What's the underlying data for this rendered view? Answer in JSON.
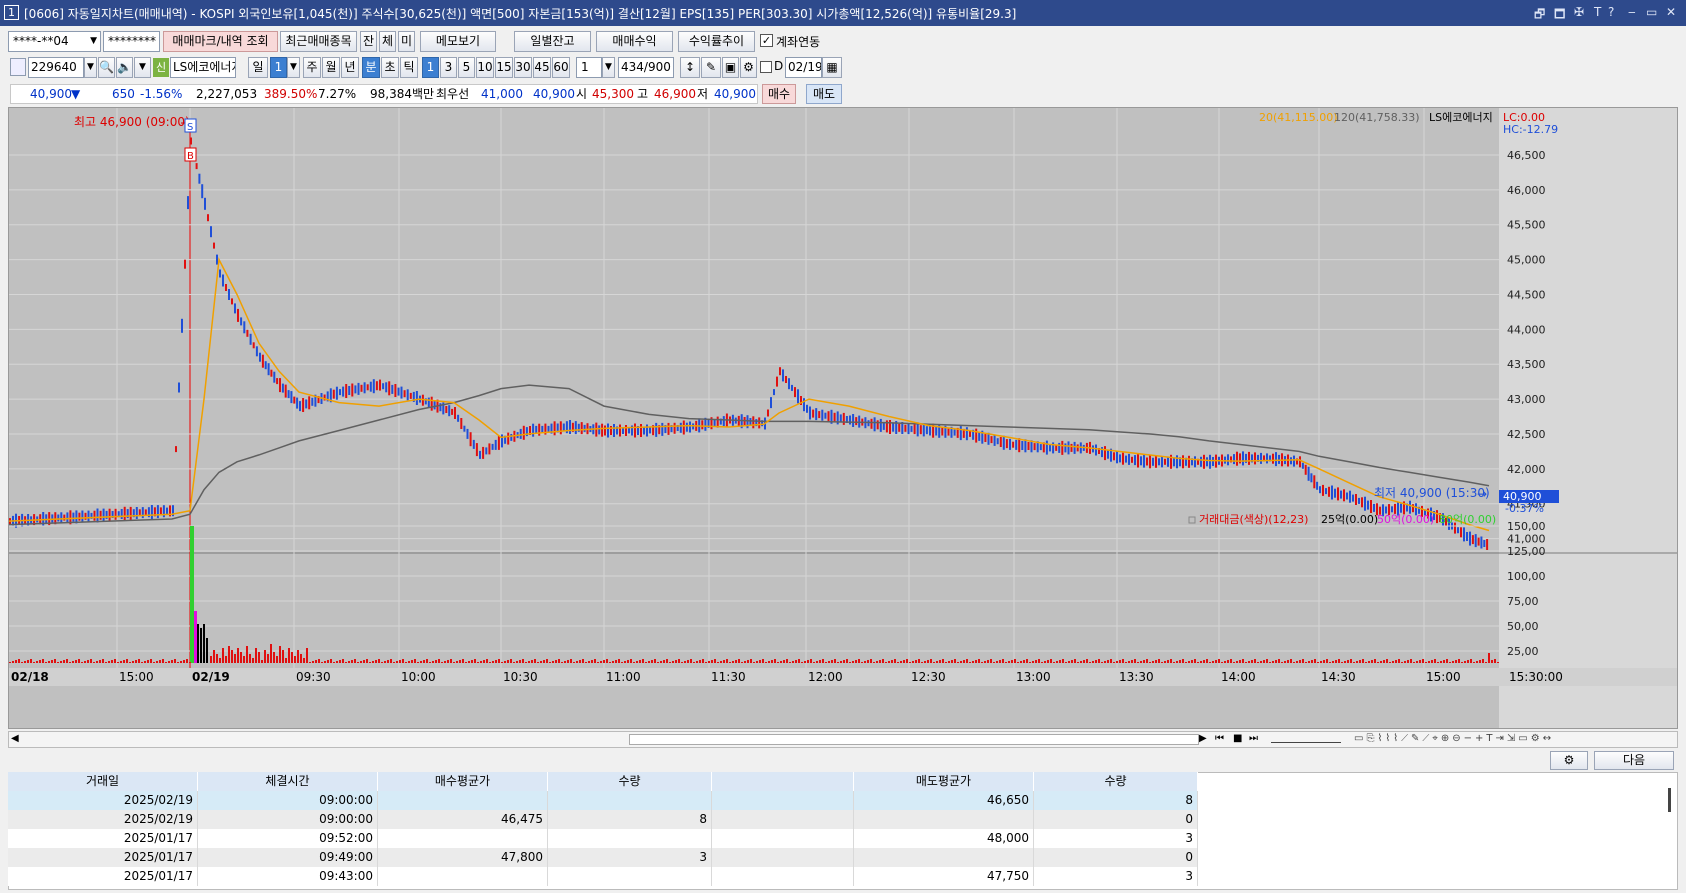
{
  "title": {
    "number": "1",
    "text": "[0606] 자동일지차트(매매내역) - KOSPI 외국인보유[1,045(천)] 주식수[30,625(천)] 액면[500] 자본금[153(억)] 결산[12월] EPS[135] PER[303.30] 시가총액[12,526(억)] 유통비율[29.3]",
    "controls": [
      "🗗",
      "🗖",
      "✠",
      "T",
      "?",
      "‒",
      "▭",
      "✕"
    ]
  },
  "toolbar1": {
    "account": "****-**04",
    "password": "********",
    "tabs": [
      "매매마크/내역 조회",
      "최근매매종목",
      "잔",
      "체",
      "미",
      "메모보기",
      "일별잔고",
      "매매수익",
      "수익률추이"
    ],
    "link_label": "계좌연동"
  },
  "toolbar2": {
    "code": "229640",
    "stock_prefix": "신",
    "stock_name": "LS에코에너지",
    "exclaim": "!",
    "period_tabs": [
      "일",
      "1",
      "주",
      "월",
      "년",
      "분",
      "초",
      "틱"
    ],
    "intervals": [
      "1",
      "3",
      "5",
      "10",
      "15",
      "30",
      "45",
      "60"
    ],
    "count_value": "1",
    "bars": "434",
    "bars_total": "/900",
    "d_label": "D",
    "date": "02/19"
  },
  "quote": {
    "price": "40,900",
    "arrow": "▼",
    "change": "650",
    "rate": "-1.56%",
    "volume": "2,227,053",
    "vol_rate": "389.50%",
    "turnover": "7.27%",
    "amount": "98,384백만",
    "best_label": "최우선",
    "ask": "41,000",
    "bid": "40,900",
    "open_label": "시",
    "open": "45,300",
    "high_label": "고",
    "high": "46,900",
    "low_label": "저",
    "low": "40,900",
    "buy_btn": "매수",
    "sell_btn": "매도"
  },
  "chart": {
    "legend": {
      "ma20": "20(41,115.00)",
      "ma120": "120(41,758.33)",
      "name": "LS에코에너지",
      "lc": "LC:0.00",
      "hc": "HC:-12.79"
    },
    "high_marker": "최고 46,900 (09:00)",
    "low_marker": "최저 40,900 (15:30)",
    "sell_mark": "S",
    "buy_mark": "B",
    "current_price": "40,900",
    "current_rate": "-0.37%",
    "price_ticks": [
      "46,500",
      "46,000",
      "45,500",
      "45,000",
      "44,500",
      "44,000",
      "43,500",
      "43,000",
      "42,500",
      "42,000",
      "41,500",
      "41,000"
    ],
    "vol_legend": {
      "main": "거래대금(색상)(12,23)",
      "l25": "25억(0.00)",
      "l50": "50억(0.00)",
      "l80": "80억(0.00)"
    },
    "vol_ticks": [
      "150,00",
      "125,00",
      "100,00",
      "75,00",
      "50,00",
      "25,00"
    ],
    "time_labels": [
      "02/18",
      "15:00",
      "02/19",
      "09:30",
      "10:00",
      "10:30",
      "11:00",
      "11:30",
      "12:00",
      "12:30",
      "13:00",
      "13:30",
      "14:00",
      "14:30",
      "15:00"
    ],
    "time_corner": "15:30:00",
    "colors": {
      "up": "#e01010",
      "down": "#1f4fd8",
      "ma20": "#f0a000",
      "ma120": "#606060",
      "bg": "#c0c0c0"
    }
  },
  "chart_data": {
    "type": "line",
    "xlabel": "",
    "ylabel": "",
    "ylim": [
      40750,
      46900
    ],
    "x": [
      "02/18 14:40",
      "02/18 15:20",
      "02/19 09:00",
      "09:05",
      "09:10",
      "09:15",
      "09:20",
      "09:25",
      "09:30",
      "09:40",
      "09:50",
      "10:00",
      "10:10",
      "10:20",
      "10:30",
      "10:40",
      "10:50",
      "11:00",
      "11:10",
      "11:20",
      "11:30",
      "11:40",
      "11:50",
      "12:00",
      "12:10",
      "12:20",
      "12:30",
      "12:40",
      "12:50",
      "13:00",
      "13:10",
      "13:20",
      "13:30",
      "13:40",
      "13:50",
      "14:00",
      "14:10",
      "14:20",
      "14:30",
      "14:40",
      "14:50",
      "15:00",
      "15:10",
      "15:20",
      "15:30"
    ],
    "series": [
      {
        "name": "price",
        "values": [
          41250,
          41400,
          46700,
          45800,
          44800,
          44200,
          43600,
          43200,
          42900,
          43100,
          43200,
          43000,
          42800,
          42200,
          42400,
          42550,
          42600,
          42550,
          42550,
          42600,
          42700,
          42650,
          43400,
          42800,
          42700,
          42600,
          42550,
          42500,
          42350,
          42300,
          42300,
          42150,
          42100,
          42100,
          42100,
          42150,
          42150,
          42100,
          41700,
          41600,
          41400,
          41450,
          41300,
          41000,
          40900
        ]
      },
      {
        "name": "20",
        "values": [
          41250,
          41350,
          41400,
          43000,
          45000,
          44500,
          43800,
          43400,
          43100,
          42950,
          42900,
          43000,
          42950,
          42700,
          42450,
          42500,
          42550,
          42580,
          42600,
          42620,
          42600,
          42640,
          42800,
          43000,
          42900,
          42750,
          42620,
          42550,
          42450,
          42350,
          42300,
          42250,
          42200,
          42150,
          42120,
          42110,
          42120,
          42130,
          42000,
          41800,
          41600,
          41480,
          41350,
          41200,
          41115
        ]
      },
      {
        "name": "120",
        "values": [
          41200,
          41280,
          41350,
          41700,
          41950,
          42100,
          42200,
          42300,
          42400,
          42550,
          42700,
          42850,
          42950,
          43050,
          43150,
          43200,
          43150,
          42900,
          42780,
          42720,
          42700,
          42680,
          42680,
          42680,
          42670,
          42660,
          42640,
          42620,
          42600,
          42580,
          42560,
          42530,
          42500,
          42460,
          42400,
          42350,
          42300,
          42250,
          42180,
          42100,
          42020,
          41950,
          41880,
          41810,
          41758
        ]
      }
    ]
  },
  "scrollbar": {
    "icons": [
      "▶",
      "⏮",
      "■",
      "⏭"
    ]
  },
  "bottom": {
    "settings_icon": "gear-icon",
    "next_btn": "다음",
    "headers": [
      "거래일",
      "체결시간",
      "매수평균가",
      "수량",
      "",
      "매도평균가",
      "수량"
    ],
    "rows": [
      [
        "2025/02/19",
        "09:00:00",
        "",
        "",
        "",
        "46,650",
        "8"
      ],
      [
        "2025/02/19",
        "09:00:00",
        "46,475",
        "8",
        "",
        "",
        "0"
      ],
      [
        "2025/01/17",
        "09:52:00",
        "",
        "",
        "",
        "48,000",
        "3"
      ],
      [
        "2025/01/17",
        "09:49:00",
        "47,800",
        "3",
        "",
        "",
        "0"
      ],
      [
        "2025/01/17",
        "09:43:00",
        "",
        "",
        "",
        "47,750",
        "3"
      ]
    ]
  }
}
